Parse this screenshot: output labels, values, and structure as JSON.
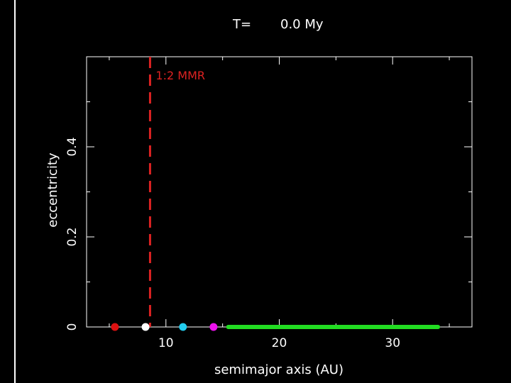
{
  "chart_data": {
    "type": "scatter",
    "title_label": "T=",
    "title_value": "0.0 My",
    "xlabel": "semimajor axis (AU)",
    "ylabel": "eccentricity",
    "xlim": [
      3,
      37
    ],
    "ylim": [
      0,
      0.6
    ],
    "x_ticks": [
      10,
      20,
      30
    ],
    "x_tick_labels": [
      "10",
      "20",
      "30"
    ],
    "y_ticks": [
      0,
      0.2,
      0.4
    ],
    "y_tick_labels": [
      "0",
      "0.2",
      "0.4"
    ],
    "x_minor_ticks": [
      5,
      15,
      25,
      35
    ],
    "y_minor_ticks": [
      0.1,
      0.3,
      0.5
    ],
    "grid": false,
    "background": "#000000",
    "axis_color": "#ffffff",
    "planets": [
      {
        "x": 5.5,
        "y": 0.0,
        "color": "#dd1111"
      },
      {
        "x": 8.2,
        "y": 0.0,
        "color": "#ffffff"
      },
      {
        "x": 11.5,
        "y": 0.0,
        "color": "#22ccee"
      },
      {
        "x": 14.2,
        "y": 0.0,
        "color": "#ee11ee"
      }
    ],
    "disk": {
      "x_min": 15.5,
      "x_max": 34.0,
      "y": 0.0,
      "color": "#22dd22"
    },
    "annotations": [
      {
        "text": "1:2 MMR",
        "x": 8.6,
        "color": "#dd2222",
        "style": "dashed vertical line"
      }
    ]
  }
}
